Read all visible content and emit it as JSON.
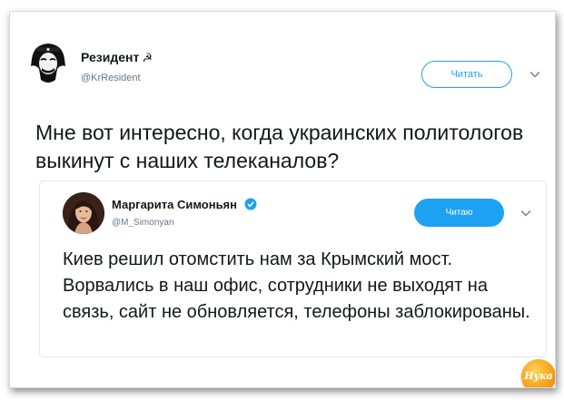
{
  "outer_tweet": {
    "author_name": "Резидент",
    "author_badge": "☭",
    "handle": "@KrResident",
    "follow_label": "Читать",
    "text": "Мне вот интересно, когда украинских политологов выкинут с наших телеканалов?"
  },
  "quoted_tweet": {
    "author_name": "Маргарита Симоньян",
    "handle": "@M_Simonyan",
    "follow_label": "Читаю",
    "text": "Киев решил отомстить нам за Крымский мост. Ворвались в наш офис, сотрудники не выходят на связь, сайт не обновляется, телефоны заблокированы."
  },
  "watermark": {
    "label": "Нука"
  },
  "colors": {
    "accent": "#1da1f2",
    "text": "#14171a",
    "secondary": "#657786"
  },
  "icons": [
    "che-guevara-mask-avatar",
    "verified-badge-icon",
    "chevron-down-icon"
  ]
}
